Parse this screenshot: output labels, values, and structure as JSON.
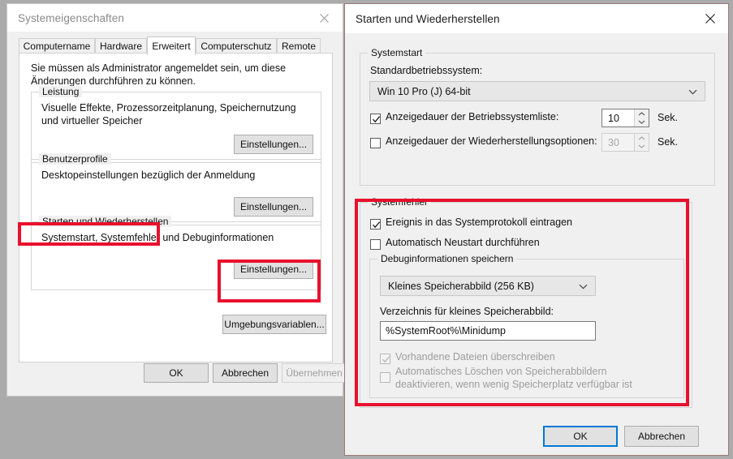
{
  "colors": {
    "accent_blue": "#0078d7",
    "annotation_red": "#e8112d",
    "window_frame": "#9b7a75",
    "desktop": "#ababab"
  },
  "left_dialog": {
    "title": "Systemeigenschaften",
    "close_icon": "close-icon",
    "tabs": [
      {
        "label": "Computername",
        "active": false
      },
      {
        "label": "Hardware",
        "active": false
      },
      {
        "label": "Erweitert",
        "active": true
      },
      {
        "label": "Computerschutz",
        "active": false
      },
      {
        "label": "Remote",
        "active": false
      }
    ],
    "lead_text": "Sie müssen als Administrator angemeldet sein, um diese Änderungen durchführen zu können.",
    "groups": [
      {
        "legend": "Leistung",
        "description": "Visuelle Effekte, Prozessorzeitplanung, Speichernutzung und virtueller Speicher",
        "button": "Einstellungen..."
      },
      {
        "legend": "Benutzerprofile",
        "description": "Desktopeinstellungen bezüglich der Anmeldung",
        "button": "Einstellungen..."
      },
      {
        "legend": "Starten und Wiederherstellen",
        "description": "Systemstart, Systemfehler und Debuginformationen",
        "button": "Einstellungen..."
      }
    ],
    "env_button": "Umgebungsvariablen...",
    "footer": {
      "ok": "OK",
      "cancel": "Abbrechen",
      "apply": "Übernehmen",
      "apply_disabled": true
    }
  },
  "right_dialog": {
    "title": "Starten und Wiederherstellen",
    "close_icon": "close-icon",
    "startup_group": {
      "legend": "Systemstart",
      "os_label": "Standardbetriebssystem:",
      "os_value": "Win 10  Pro (J) 64-bit",
      "os_dropdown_icon": "chevron-down-icon",
      "timeout_oslist": {
        "label": "Anzeigedauer der Betriebssystemliste:",
        "checked": true,
        "value": "10",
        "unit": "Sek."
      },
      "timeout_recovery": {
        "label": "Anzeigedauer der Wiederherstellungsoptionen:",
        "checked": false,
        "enabled": false,
        "value": "30",
        "unit": "Sek."
      }
    },
    "error_group": {
      "legend": "Systemfehler",
      "log_event": {
        "label": "Ereignis in das Systemprotokoll eintragen",
        "checked": true
      },
      "auto_restart": {
        "label": "Automatisch Neustart durchführen",
        "checked": false
      },
      "debug_group": {
        "legend": "Debuginformationen speichern",
        "dump_type": "Kleines Speicherabbild (256 KB)",
        "dump_dropdown_icon": "chevron-down-icon",
        "dir_label": "Verzeichnis für kleines Speicherabbild:",
        "dir_value": "%SystemRoot%\\Minidump",
        "overwrite": {
          "label": "Vorhandene Dateien überschreiben",
          "checked": true,
          "enabled": false
        },
        "disable_autodelete": {
          "label": "Automatisches Löschen von Speicherabbildern deaktivieren, wenn wenig Speicherplatz verfügbar ist",
          "checked": false,
          "enabled": false
        }
      }
    },
    "footer": {
      "ok": "OK",
      "cancel": "Abbrechen"
    }
  }
}
